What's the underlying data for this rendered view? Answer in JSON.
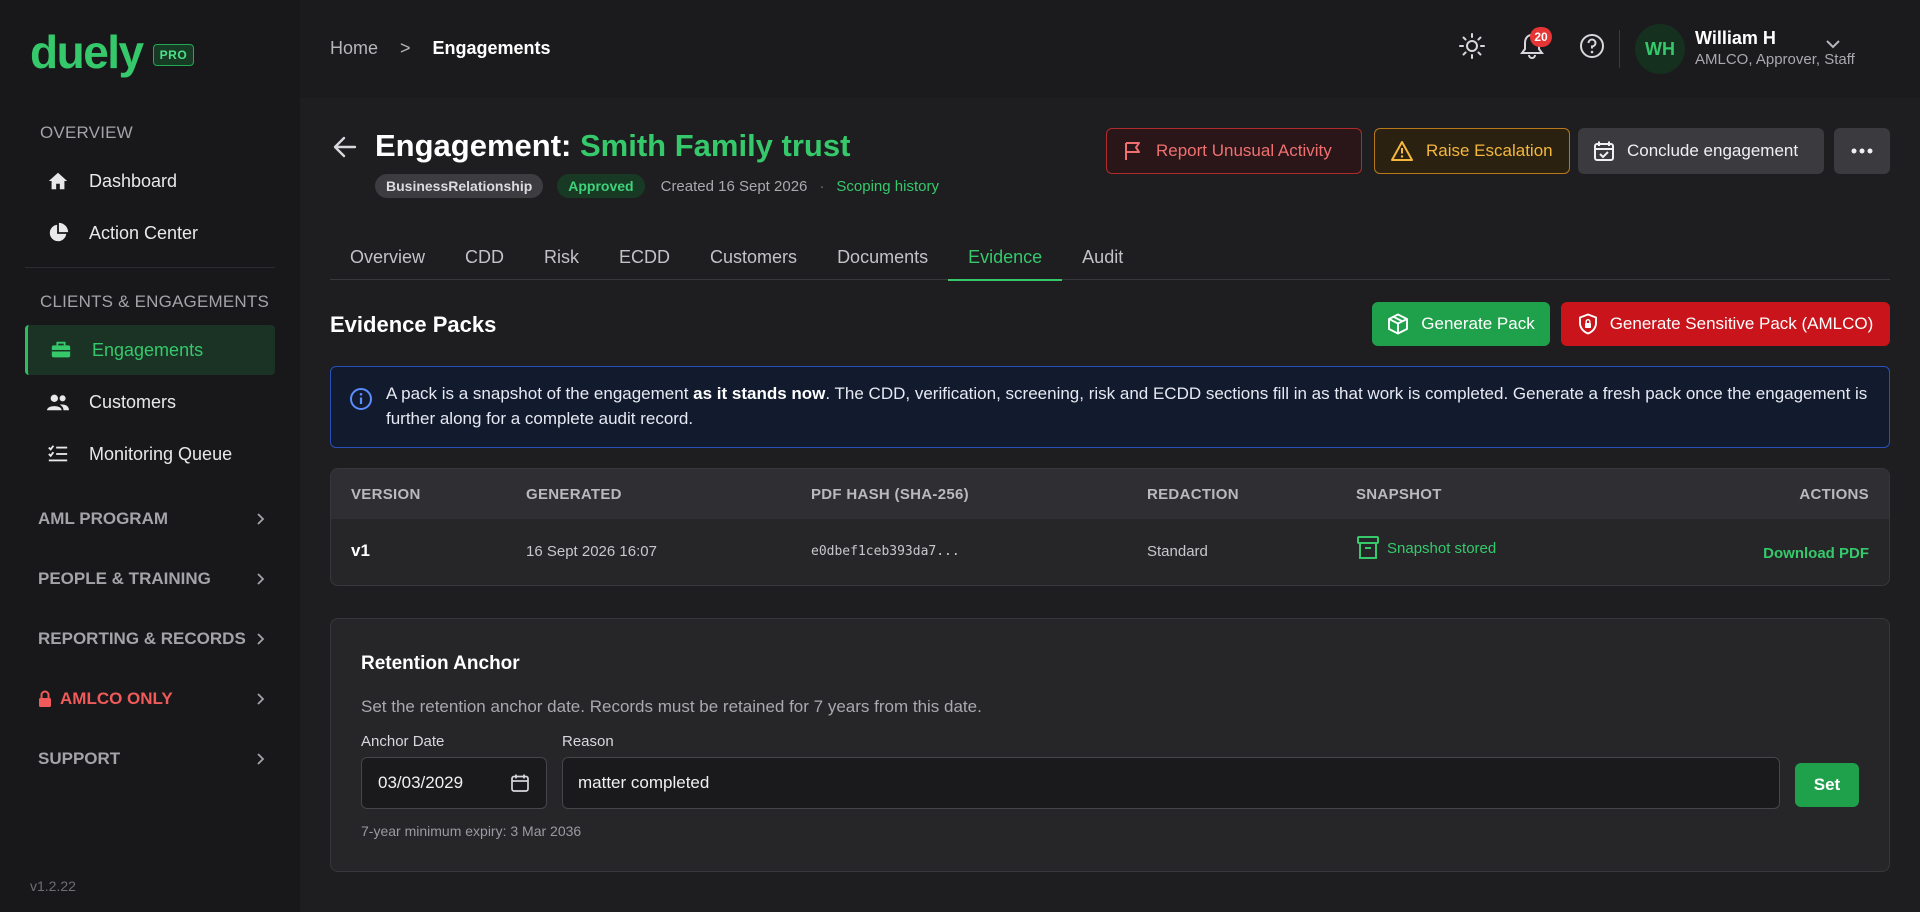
{
  "brand": {
    "name": "duely",
    "badge": "PRO",
    "accent": "#35c96b"
  },
  "sidebar": {
    "overview_heading": "OVERVIEW",
    "overview_items": [
      {
        "label": "Dashboard",
        "icon": "home-icon"
      },
      {
        "label": "Action Center",
        "icon": "pie-chart-icon"
      }
    ],
    "clients_heading": "CLIENTS & ENGAGEMENTS",
    "clients_items": [
      {
        "label": "Engagements",
        "icon": "briefcase-icon",
        "active": true
      },
      {
        "label": "Customers",
        "icon": "users-icon"
      },
      {
        "label": "Monitoring Queue",
        "icon": "list-check-icon"
      }
    ],
    "groups": [
      {
        "label": "AML PROGRAM"
      },
      {
        "label": "PEOPLE & TRAINING"
      },
      {
        "label": "REPORTING & RECORDS"
      },
      {
        "label": "AMLCO ONLY",
        "icon": "lock-icon",
        "color": "#f05a5a"
      },
      {
        "label": "SUPPORT"
      }
    ],
    "version": "v1.2.22"
  },
  "topbar": {
    "breadcrumb_home": "Home",
    "breadcrumb_sep": ">",
    "breadcrumb_current": "Engagements",
    "notification_count": "20",
    "user": {
      "initials": "WH",
      "name": "William H",
      "roles": "AMLCO, Approver, Staff"
    }
  },
  "engagement": {
    "title_prefix": "Engagement:",
    "title_name": "Smith Family trust",
    "type_pill": "BusinessRelationship",
    "status_pill": "Approved",
    "created": "Created 16 Sept 2026",
    "separator": "·",
    "history_link": "Scoping history"
  },
  "actions": {
    "report": "Report Unusual Activity",
    "escalate": "Raise Escalation",
    "conclude": "Conclude engagement"
  },
  "tabs": [
    "Overview",
    "CDD",
    "Risk",
    "ECDD",
    "Customers",
    "Documents",
    "Evidence",
    "Audit"
  ],
  "active_tab": "Evidence",
  "evidence": {
    "title": "Evidence Packs",
    "generate_label": "Generate Pack",
    "generate_sensitive_label": "Generate Sensitive Pack (AMLCO)",
    "info_pre": "A pack is a snapshot of the engagement ",
    "info_bold": "as it stands now",
    "info_post": ". The CDD, verification, screening, risk and ECDD sections fill in as that work is completed. Generate a fresh pack once the engagement is further along for a complete audit record.",
    "table": {
      "headers": {
        "version": "VERSION",
        "generated": "GENERATED",
        "hash": "PDF HASH (SHA-256)",
        "redaction": "REDACTION",
        "snapshot": "SNAPSHOT",
        "actions": "ACTIONS"
      },
      "rows": [
        {
          "version": "v1",
          "generated": "16 Sept 2026 16:07",
          "hash": "e0dbef1ceb393da7...",
          "redaction": "Standard",
          "snapshot": "Snapshot stored",
          "action": "Download PDF"
        }
      ]
    }
  },
  "retention": {
    "title": "Retention Anchor",
    "description": "Set the retention anchor date. Records must be retained for 7 years from this date.",
    "anchor_label": "Anchor Date",
    "anchor_value": "03/03/2029",
    "reason_label": "Reason",
    "reason_value": "matter completed",
    "set_label": "Set",
    "note": "7-year minimum expiry: 3 Mar 2036"
  }
}
